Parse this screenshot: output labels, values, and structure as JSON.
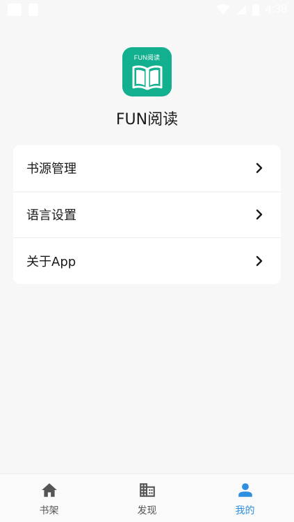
{
  "status_bar": {
    "time": "4:38",
    "icons": [
      "notification-square-icon",
      "notification-square-icon",
      "wifi-icon",
      "signal-icon",
      "battery-icon"
    ]
  },
  "app": {
    "logo_text": "FUN阅读",
    "name": "FUN阅读",
    "logo_color": "#12b08f"
  },
  "menu": {
    "items": [
      {
        "label": "书源管理",
        "icon": "chevron-right-icon"
      },
      {
        "label": "语言设置",
        "icon": "chevron-right-icon"
      },
      {
        "label": "关于App",
        "icon": "chevron-right-icon"
      }
    ]
  },
  "bottom_nav": {
    "items": [
      {
        "label": "书架",
        "icon": "home-icon",
        "active": false
      },
      {
        "label": "发现",
        "icon": "building-icon",
        "active": false
      },
      {
        "label": "我的",
        "icon": "person-icon",
        "active": true
      }
    ],
    "active_color": "#2e8ee0",
    "inactive_color": "#555555"
  }
}
